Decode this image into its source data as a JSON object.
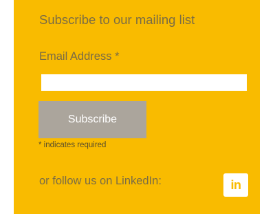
{
  "colors": {
    "panel_background": "#f9bb00",
    "text": "#7a6c45",
    "button_background": "#aba59c",
    "button_text": "#ffffff",
    "input_background": "#ffffff",
    "linkedin_background": "#ffffff",
    "linkedin_glyph": "#f9bb00"
  },
  "form": {
    "heading": "Subscribe to our mailing list",
    "email_label": "Email Address",
    "required_marker": "*",
    "email_value": "",
    "subscribe_label": "Subscribe",
    "required_note_marker": "*",
    "required_note_text": " indicates required"
  },
  "social": {
    "follow_text": "or follow us on LinkedIn:",
    "linkedin_icon": "linkedin-icon",
    "linkedin_glyph": "in"
  }
}
